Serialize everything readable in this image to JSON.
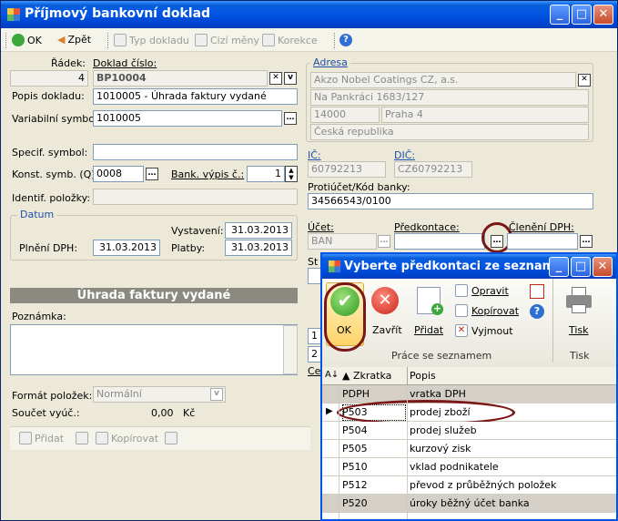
{
  "window": {
    "title": "Příjmový bankovní doklad"
  },
  "toolbar": {
    "ok": "OK",
    "zpet": "Zpět",
    "typ_dokladu": "Typ dokladu",
    "cizi_meny": "Cizí měny",
    "korekce": "Korekce"
  },
  "form": {
    "radek_label": "Řádek:",
    "radek_value": "4",
    "doklad_label": "Doklad číslo:",
    "doklad_value": "BP10004",
    "popis_label": "Popis dokladu:",
    "popis_value": "1010005 - Úhrada faktury vydané",
    "vs_label": "Variabilní symbol:",
    "vs_value": "1010005",
    "spec_label": "Specif. symbol:",
    "spec_value": "",
    "konst_label": "Konst. symb. (Q):",
    "konst_value": "0008",
    "bank_label": "Bank. výpis č.:",
    "bank_value": "1",
    "identif_label": "Identif. položky:",
    "datum_title": "Datum",
    "vystaveni_label": "Vystavení:",
    "vystaveni_value": "31.03.2013",
    "plneni_label": "Plnění DPH:",
    "plneni_value": "31.03.2013",
    "platby_label": "Platby:",
    "platby_value": "31.03.2013",
    "section_title": "Úhrada faktury vydané",
    "poznamka_label": "Poznámka:",
    "format_label": "Formát položek:",
    "format_value": "Normální",
    "soucet_label": "Součet vyúč.:",
    "soucet_value": "0,00",
    "soucet_currency": "Kč",
    "pridat": "Přidat",
    "kopirovat": "Kopírovat"
  },
  "address": {
    "title": "Adresa",
    "name": "Akzo Nobel Coatings CZ, a.s.",
    "street": "Na Pankráci 1683/127",
    "zip": "14000",
    "city": "Praha 4",
    "country": "Česká republika",
    "ic_label": "IČ:",
    "ic_value": "60792213",
    "dic_label": "DIČ:",
    "dic_value": "CZ60792213",
    "protiucet_label": "Protiúčet/Kód banky:",
    "protiucet_value": "34566543/0100",
    "ucet_label": "Účet:",
    "ucet_value": "BAN",
    "predkontace_label": "Předkontace:",
    "cleneni_label": "Členění DPH:",
    "st_label": "St",
    "ce_label": "Ce",
    "row1": "1",
    "row2": "2"
  },
  "dialog": {
    "title": "Vyberte předkontaci ze seznamu",
    "ok": "OK",
    "zavrit": "Zavřít",
    "pridat": "Přidat",
    "opravit": "Opravit",
    "kopirovat": "Kopírovat",
    "vyjmout": "Vyjmout",
    "tisk": "Tisk",
    "group_prace": "Práce se seznamem",
    "group_tisk": "Tisk",
    "col_zkratka": "Zkratka",
    "col_popis": "Popis",
    "rows": [
      {
        "zkratka": "PDPH",
        "popis": "vratka DPH"
      },
      {
        "zkratka": "P503",
        "popis": "prodej zboží"
      },
      {
        "zkratka": "P504",
        "popis": "prodej služeb"
      },
      {
        "zkratka": "P505",
        "popis": "kurzový zisk"
      },
      {
        "zkratka": "P510",
        "popis": "vklad podnikatele"
      },
      {
        "zkratka": "P512",
        "popis": "převod z průběžných položek"
      },
      {
        "zkratka": "P520",
        "popis": "úroky běžný účet banka"
      }
    ]
  },
  "colors": {
    "titlebar": "#0054e3",
    "highlight": "#7a1717",
    "accent_link": "#1f4fa8"
  }
}
